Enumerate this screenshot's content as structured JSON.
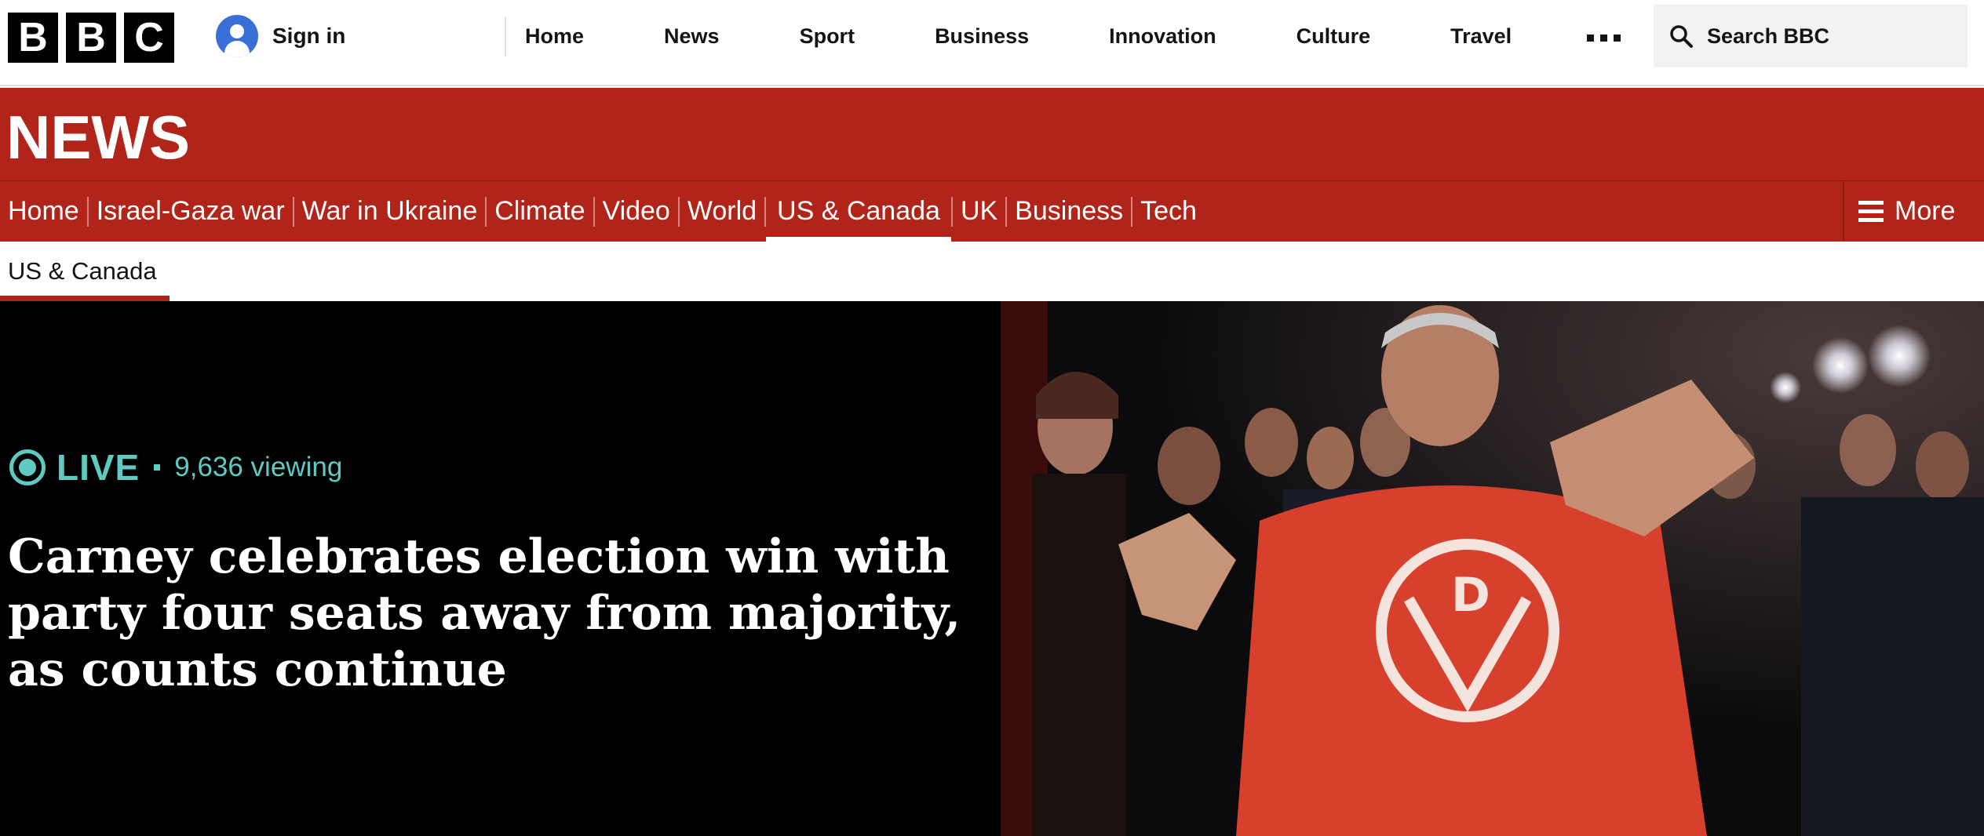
{
  "masthead": {
    "logo_letters": [
      "B",
      "B",
      "C"
    ],
    "signin_label": "Sign in",
    "nav": [
      "Home",
      "News",
      "Sport",
      "Business",
      "Innovation",
      "Culture",
      "Travel"
    ],
    "more_icon": "ellipsis-icon",
    "search_label": "Search BBC"
  },
  "news_banner": {
    "title": "NEWS",
    "sections": [
      "Home",
      "Israel-Gaza war",
      "War in Ukraine",
      "Climate",
      "Video",
      "World",
      "US & Canada",
      "UK",
      "Business",
      "Tech"
    ],
    "active_section": "US & Canada",
    "more_label": "More"
  },
  "subsection": {
    "label": "US & Canada"
  },
  "hero": {
    "live_label": "LIVE",
    "viewers": "9,636 viewing",
    "headline": "Carney celebrates election win with party four seats away from majority, as counts continue",
    "photo_subject": "man in red hooded jumper waving both hands in a crowd"
  },
  "colors": {
    "brand_red": "#b02419",
    "live_teal": "#5ecac1",
    "hero_bg": "#000000"
  }
}
